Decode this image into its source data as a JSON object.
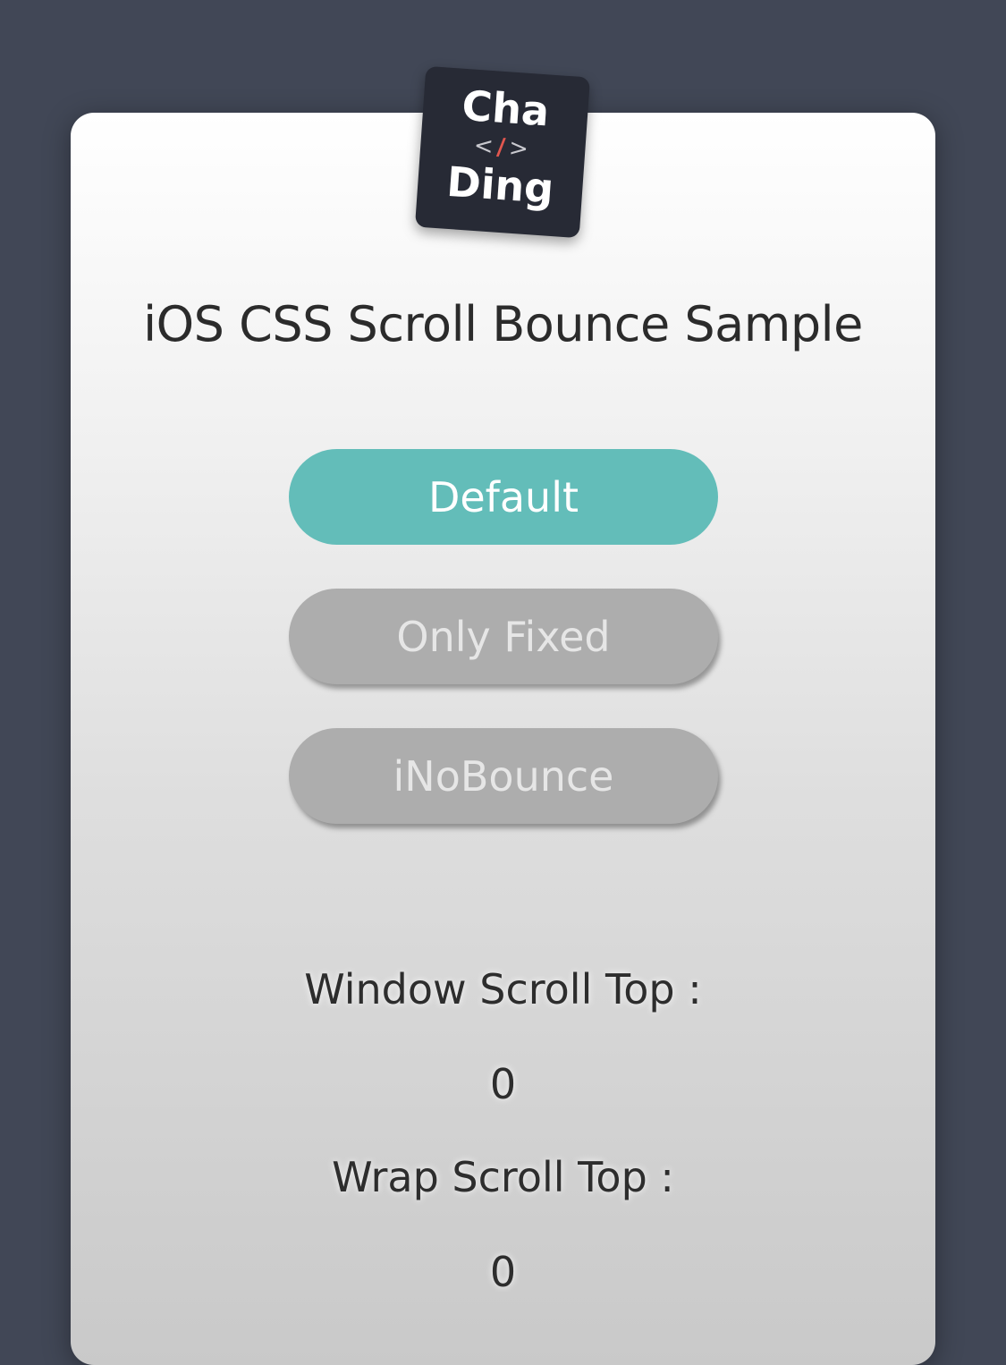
{
  "logo": {
    "line1": "Cha",
    "code_open": "<",
    "code_slash": "/",
    "code_close": ">",
    "line2": "Ding"
  },
  "title": "iOS CSS Scroll Bounce Sample",
  "buttons": [
    {
      "label": "Default",
      "state": "active"
    },
    {
      "label": "Only Fixed",
      "state": "inactive"
    },
    {
      "label": "iNoBounce",
      "state": "inactive"
    }
  ],
  "stats": {
    "window_label": "Window Scroll Top :",
    "window_value": "0",
    "wrap_label": "Wrap Scroll Top :",
    "wrap_value": "0"
  },
  "colors": {
    "background": "#414756",
    "active_button": "#63bdb9",
    "inactive_button": "#adadad",
    "logo_bg": "#272a35",
    "logo_accent": "#e2574f"
  }
}
